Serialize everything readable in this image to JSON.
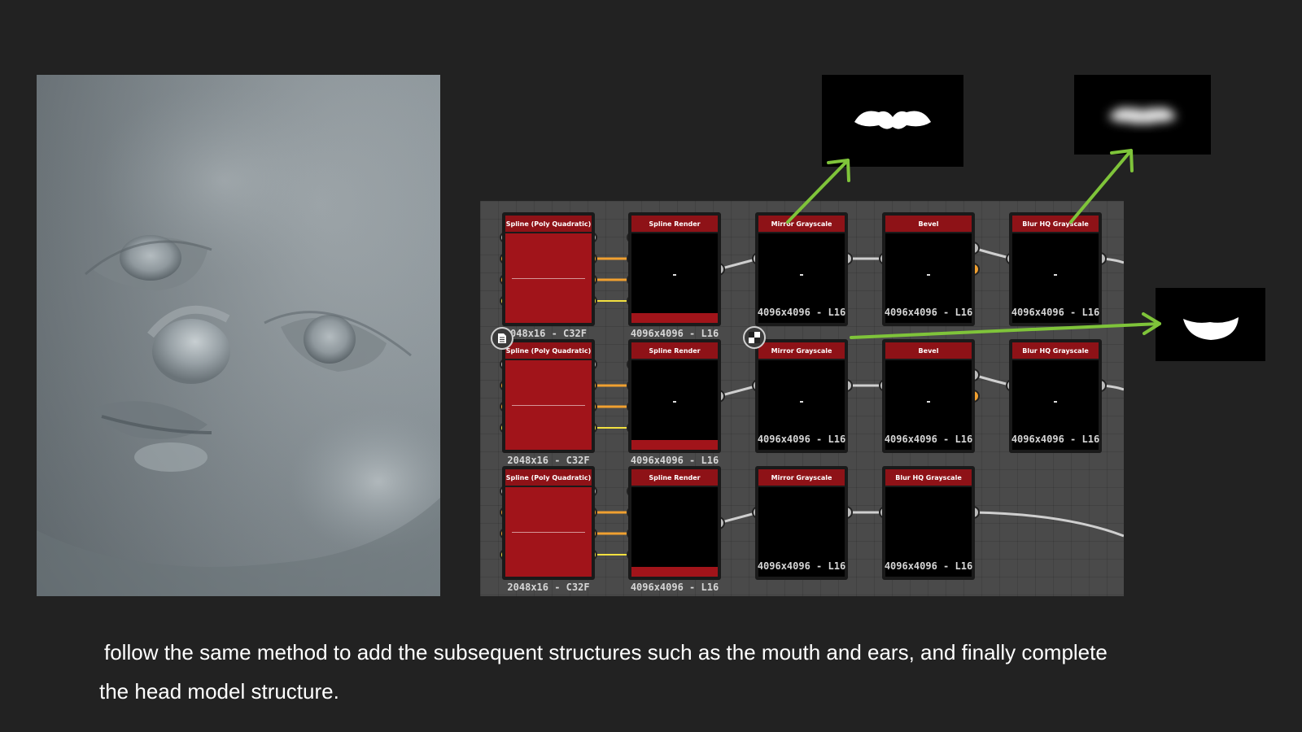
{
  "caption": {
    "line1": "follow the same method to add the subsequent structures such as the mouth and ears, and finally complete",
    "line2": "the head model structure."
  },
  "graph": {
    "rows": [
      {
        "nodes": [
          {
            "title": "Spline (Poly Quadratic)",
            "size": "048x16 - C32F"
          },
          {
            "title": "Spline Render",
            "size": "4096x4096 - L16"
          },
          {
            "title": "Mirror Grayscale",
            "size": "4096x4096 - L16"
          },
          {
            "title": "Bevel",
            "size": "4096x4096 - L16"
          },
          {
            "title": "Blur HQ Grayscale",
            "size": "4096x4096 - L16"
          }
        ]
      },
      {
        "nodes": [
          {
            "title": "Spline (Poly Quadratic)",
            "size": "2048x16 - C32F"
          },
          {
            "title": "Spline Render",
            "size": "4096x4096 - L16"
          },
          {
            "title": "Mirror Grayscale",
            "size": "4096x4096 - L16"
          },
          {
            "title": "Bevel",
            "size": "4096x4096 - L16"
          },
          {
            "title": "Blur HQ Grayscale",
            "size": "4096x4096 - L16"
          }
        ]
      },
      {
        "nodes": [
          {
            "title": "Spline (Poly Quadratic)",
            "size": "2048x16 - C32F"
          },
          {
            "title": "Spline Render",
            "size": "4096x4096 - L16"
          },
          {
            "title": "Mirror Grayscale",
            "size": "4096x4096 - L16"
          },
          {
            "title": "Blur HQ Grayscale",
            "size": "4096x4096 - L16"
          }
        ]
      }
    ]
  },
  "icons": {
    "document_badge": "document-icon",
    "checker_badge": "checker-icon"
  },
  "colors": {
    "background": "#222222",
    "node_header": "#8e1217",
    "arrow": "#7fc43a",
    "socket_orange": "#f0a030",
    "socket_yellow": "#f2e040",
    "socket_gray": "#bbbbbb"
  }
}
